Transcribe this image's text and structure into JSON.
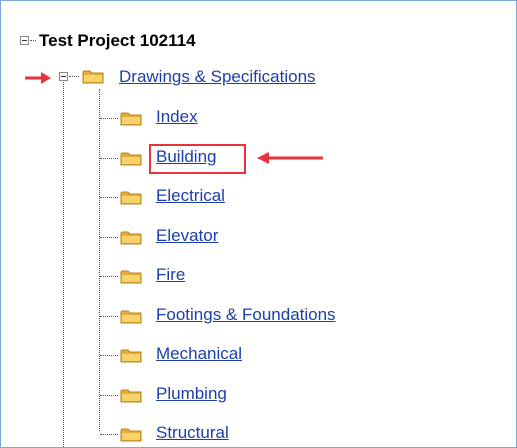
{
  "tree": {
    "root": {
      "title": "Test Project 102114"
    },
    "folder": {
      "label": "Drawings & Specifications"
    },
    "children": [
      {
        "label": "Index"
      },
      {
        "label": "Building"
      },
      {
        "label": "Electrical"
      },
      {
        "label": "Elevator"
      },
      {
        "label": "Fire"
      },
      {
        "label": "Footings & Foundations"
      },
      {
        "label": "Mechanical"
      },
      {
        "label": "Plumbing"
      },
      {
        "label": "Structural"
      }
    ]
  },
  "annotations": {
    "color": "#e8323c",
    "highlighted_item": "Building"
  },
  "colors": {
    "link": "#1a3fa8",
    "frame_border": "#7aa9dc",
    "folder": "#f3c85a"
  }
}
